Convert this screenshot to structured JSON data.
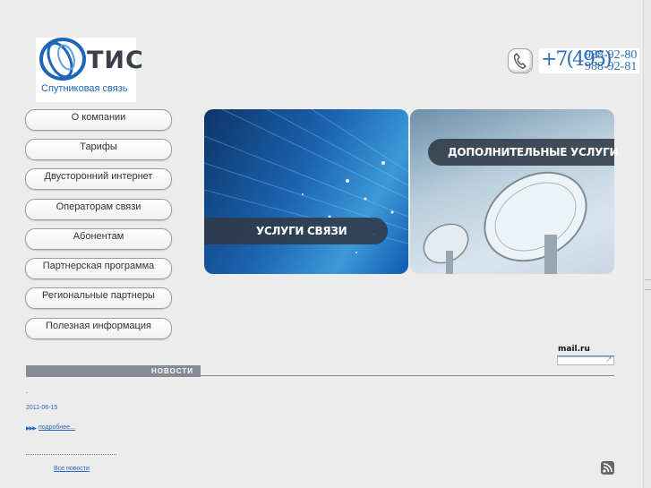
{
  "header": {
    "logo_brand": "ТИС",
    "logo_tagline": "Спутниковая связь",
    "phone": {
      "code": "+7(495)",
      "numbers": [
        "988-92-80",
        "988-92-81"
      ]
    }
  },
  "menu": {
    "items": [
      "О компании",
      "Тарифы",
      "Двусторонний интернет",
      "Операторам связи",
      "Абонентам",
      "Партнерская программа",
      "Региональные партнеры",
      "Полезная информация"
    ]
  },
  "banner": {
    "services_label": "УСЛУГИ СВЯЗИ",
    "extra_label": "ДОПОЛНИТЕЛЬНЫЕ УСЛУГИ"
  },
  "mailru": {
    "logo": "mail.ru"
  },
  "news": {
    "header": "НОВОСТИ",
    "bullet": ".",
    "date": "2011-06-15",
    "more_link": "подробнее...",
    "all_news": "Все новости"
  },
  "icons": [
    "phone-icon",
    "rss-icon",
    "arrow-icon"
  ],
  "colors": {
    "accent_blue": "#2a6fba",
    "label_dark": "#303947",
    "news_tab": "#858b92",
    "background": "#ececec"
  }
}
